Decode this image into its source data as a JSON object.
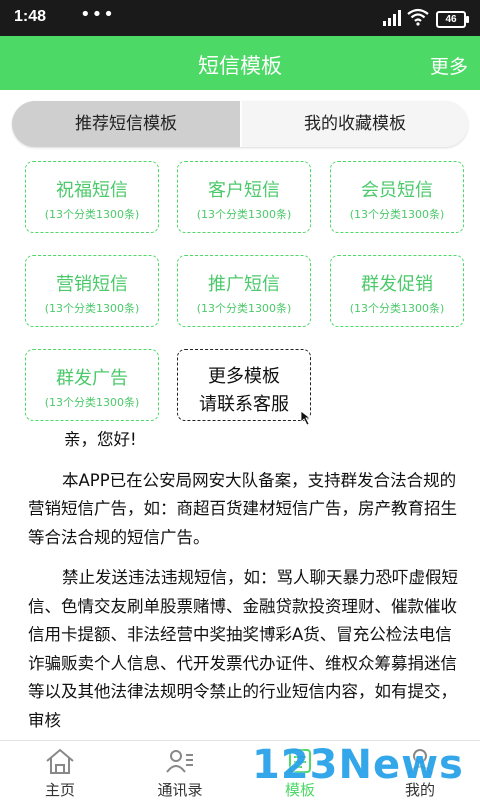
{
  "status": {
    "time": "1:48",
    "dots": "•••",
    "battery": "46"
  },
  "header": {
    "title": "短信模板",
    "more": "更多"
  },
  "tabs": {
    "recommended": "推荐短信模板",
    "favorites": "我的收藏模板"
  },
  "categories": [
    {
      "name": "祝福短信",
      "sub": "(13个分类1300条)"
    },
    {
      "name": "客户短信",
      "sub": "(13个分类1300条)"
    },
    {
      "name": "会员短信",
      "sub": "(13个分类1300条)"
    },
    {
      "name": "营销短信",
      "sub": "(13个分类1300条)"
    },
    {
      "name": "推广短信",
      "sub": "(13个分类1300条)"
    },
    {
      "name": "群发促销",
      "sub": "(13个分类1300条)"
    },
    {
      "name": "群发广告",
      "sub": "(13个分类1300条)"
    }
  ],
  "more_card": {
    "line1": "更多模板",
    "line2": "请联系客服"
  },
  "notice": {
    "greeting": "亲，您好!",
    "para1": "本APP已在公安局网安大队备案，支持群发合法合规的营销短信广告，如：商超百货建材短信广告，房产教育招生等合法合规的短信广告。",
    "para2": "禁止发送违法违规短信，如：骂人聊天暴力恐吓虚假短信、色情交友刷单股票赌博、金融贷款投资理财、催款催收信用卡提额、非法经营中奖抽奖博彩A货、冒充公检法电信诈骗贩卖个人信息、代开发票代办证件、维权众筹募捐迷信等以及其他法律法规明令禁止的行业短信内容，如有提交，审核"
  },
  "bottom_nav": [
    {
      "label": "主页",
      "icon": "home-icon"
    },
    {
      "label": "通讯录",
      "icon": "contacts-icon"
    },
    {
      "label": "模板",
      "icon": "template-icon"
    },
    {
      "label": "我的",
      "icon": "profile-icon"
    }
  ],
  "watermark": "123News",
  "colors": {
    "accent": "#4cd966",
    "card_text": "#4cc96b",
    "watermark": "#29a3e8"
  }
}
